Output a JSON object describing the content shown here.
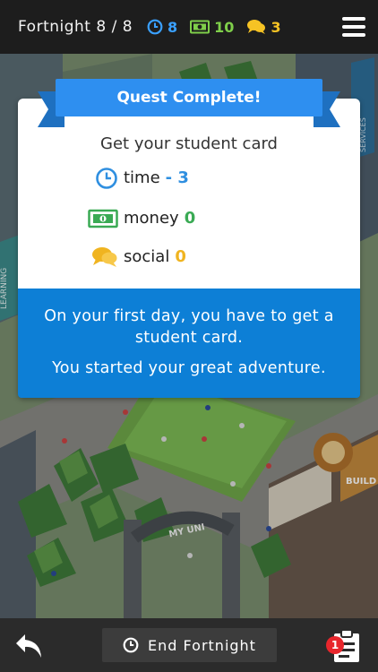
{
  "header": {
    "fortnight_label": "Fortnight 8 / 8",
    "time_value": "8",
    "money_value": "10",
    "social_value": "3"
  },
  "quest": {
    "banner": "Quest Complete!",
    "name": "Get your student card",
    "rewards": [
      {
        "icon": "clock-icon",
        "label": "time",
        "value": "- 3",
        "color": "#2f8fe0"
      },
      {
        "icon": "money-icon",
        "label": "money",
        "value": "0",
        "color": "#3aaa54"
      },
      {
        "icon": "speech-bubbles-icon",
        "label": "social",
        "value": "0",
        "color": "#f0b420"
      }
    ],
    "description_1": "On your first day, you have to get a student card.",
    "description_2": "You started your great adventure."
  },
  "scene": {
    "gate_sign": "MY UNI",
    "sign_left": "LEARNING",
    "sign_top": "SERVICES",
    "sign_right": "BUILD"
  },
  "footer": {
    "end_button_label": "End Fortnight",
    "tasks_badge": "1"
  },
  "colors": {
    "accent_blue": "#0d7fd6",
    "banner_blue": "#2e8ff0",
    "time": "#3aa0ff",
    "money": "#7fcf4a",
    "social": "#f6c324",
    "badge_red": "#e8262c"
  }
}
